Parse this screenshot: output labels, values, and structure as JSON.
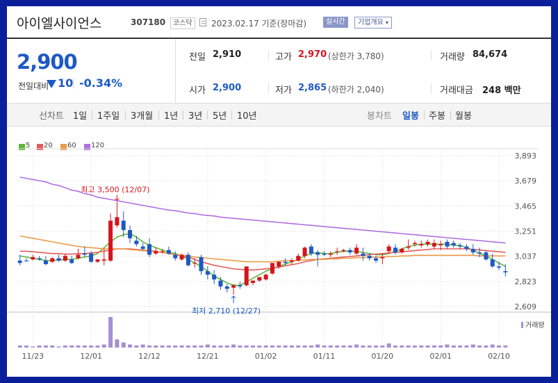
{
  "header": {
    "name": "아이엘사이언스",
    "code": "307180",
    "market": "코스닥",
    "date_text": "2023.02.17 기준(장마감)",
    "realtime_label": "실시간",
    "company_label": "기업개요"
  },
  "quote": {
    "price": "2,900",
    "change_label": "전일대비",
    "change": "10",
    "change_pct": "-0.34%"
  },
  "stats": {
    "prev_label": "전일",
    "prev_value": "2,910",
    "high_label": "고가",
    "high_value": "2,970",
    "upper_limit": "(상한가 3,780)",
    "volume_label": "거래량",
    "volume_value": "84,674",
    "open_label": "시가",
    "open_value": "2,900",
    "low_label": "저가",
    "low_value": "2,865",
    "lower_limit": "(하한가 2,040)",
    "amount_label": "거래대금",
    "amount_value": "248 백만"
  },
  "toolbar": {
    "line_label": "선차트",
    "periods": [
      "1일",
      "1주일",
      "3개월",
      "1년",
      "3년",
      "5년",
      "10년"
    ],
    "candle_label": "봉차트",
    "candles": [
      "일봉",
      "주봉",
      "월봉"
    ]
  },
  "colors": {
    "up": "#d5141c",
    "down": "#1d59c3",
    "ma5": "#61b63a",
    "ma20": "#e55a5a",
    "ma60": "#ec9a45",
    "ma120": "#b06fe0"
  },
  "chart_data": {
    "type": "candlestick",
    "ylim": [
      2609,
      3893
    ],
    "y_ticks": [
      "3,893",
      "3,679",
      "3,465",
      "3,251",
      "3,037",
      "2,823",
      "2,609"
    ],
    "x_ticks": [
      "11/23",
      "12/01",
      "12/12",
      "12/21",
      "01/02",
      "01/11",
      "01/20",
      "02/01",
      "02/10"
    ],
    "x_tick_index": [
      2,
      11,
      20,
      29,
      38,
      47,
      56,
      65,
      74
    ],
    "volume_label": "거래량",
    "high_annotation": "최고 3,500 (12/07)",
    "low_annotation": "최저 2,710 (12/27)",
    "high_index": 15,
    "low_index": 33,
    "candles": [
      [
        3000,
        3050,
        2980,
        2960
      ],
      [
        3000,
        3020,
        2995,
        2990
      ],
      [
        3010,
        3050,
        3030,
        3000
      ],
      [
        3020,
        3040,
        3010,
        3000
      ],
      [
        3000,
        3040,
        2970,
        2960
      ],
      [
        2990,
        3030,
        3020,
        2980
      ],
      [
        3020,
        3050,
        3000,
        2990
      ],
      [
        3000,
        3060,
        3040,
        2990
      ],
      [
        3010,
        3040,
        2980,
        2970
      ],
      [
        3020,
        3100,
        3050,
        3010
      ],
      [
        3060,
        3120,
        3050,
        3030
      ],
      [
        3060,
        3080,
        2990,
        2980
      ],
      [
        2990,
        3010,
        3010,
        2980
      ],
      [
        3000,
        3100,
        3010,
        2960
      ],
      [
        3000,
        3400,
        3340,
        2990
      ],
      [
        3300,
        3500,
        3370,
        3280
      ],
      [
        3340,
        3420,
        3260,
        3200
      ],
      [
        3260,
        3300,
        3190,
        3150
      ],
      [
        3170,
        3210,
        3140,
        3120
      ],
      [
        3120,
        3150,
        3100,
        3090
      ],
      [
        3140,
        3190,
        3050,
        3030
      ],
      [
        3060,
        3110,
        3080,
        3050
      ],
      [
        3080,
        3100,
        3080,
        3060
      ],
      [
        3090,
        3120,
        3060,
        3050
      ],
      [
        3050,
        3080,
        3020,
        3000
      ],
      [
        3010,
        3060,
        3050,
        3000
      ],
      [
        3050,
        3070,
        2960,
        2950
      ],
      [
        2980,
        3020,
        2980,
        2940
      ],
      [
        3030,
        3050,
        2910,
        2880
      ],
      [
        2910,
        2950,
        2880,
        2840
      ],
      [
        2880,
        2920,
        2840,
        2800
      ],
      [
        2830,
        2860,
        2780,
        2750
      ],
      [
        2780,
        2800,
        2760,
        2730
      ],
      [
        2770,
        2800,
        2790,
        2710
      ],
      [
        2790,
        2820,
        2780,
        2760
      ],
      [
        2790,
        2950,
        2950,
        2780
      ],
      [
        2810,
        2830,
        2830,
        2790
      ],
      [
        2830,
        2850,
        2860,
        2820
      ],
      [
        2840,
        2890,
        2880,
        2830
      ],
      [
        2890,
        2950,
        2980,
        2880
      ],
      [
        2950,
        2980,
        2990,
        2930
      ],
      [
        2990,
        3020,
        2980,
        2960
      ],
      [
        2990,
        3020,
        3000,
        2970
      ],
      [
        3000,
        3060,
        3040,
        2990
      ],
      [
        3040,
        3120,
        3110,
        3020
      ],
      [
        3120,
        3140,
        3060,
        3040
      ],
      [
        3070,
        3090,
        3050,
        2950
      ],
      [
        3060,
        3080,
        3050,
        3040
      ],
      [
        3050,
        3080,
        3060,
        3030
      ],
      [
        3080,
        3110,
        3080,
        3050
      ],
      [
        3080,
        3100,
        3090,
        3070
      ],
      [
        3090,
        3110,
        3070,
        3050
      ],
      [
        3060,
        3140,
        3110,
        3050
      ],
      [
        3060,
        3110,
        3040,
        3000
      ],
      [
        3040,
        3060,
        3020,
        3000
      ],
      [
        3020,
        3040,
        3000,
        2980
      ],
      [
        3020,
        3060,
        3030,
        2970
      ],
      [
        3080,
        3140,
        3120,
        3060
      ],
      [
        3110,
        3140,
        3070,
        3050
      ],
      [
        3070,
        3110,
        3100,
        3060
      ],
      [
        3110,
        3180,
        3120,
        3090
      ],
      [
        3140,
        3170,
        3150,
        3120
      ],
      [
        3130,
        3170,
        3140,
        3110
      ],
      [
        3140,
        3180,
        3160,
        3120
      ],
      [
        3120,
        3180,
        3150,
        3100
      ],
      [
        3130,
        3170,
        3140,
        3090
      ],
      [
        3160,
        3180,
        3120,
        3100
      ],
      [
        3150,
        3170,
        3130,
        3110
      ],
      [
        3130,
        3150,
        3120,
        3100
      ],
      [
        3120,
        3140,
        3100,
        3080
      ],
      [
        3100,
        3140,
        3070,
        3050
      ],
      [
        3070,
        3110,
        3060,
        3030
      ],
      [
        3070,
        3090,
        3010,
        3000
      ],
      [
        3010,
        3060,
        2950,
        2940
      ],
      [
        2950,
        2990,
        2940,
        2920
      ],
      [
        2910,
        2970,
        2900,
        2865
      ]
    ],
    "volume": [
      2,
      2,
      1,
      2,
      2,
      2,
      1,
      2,
      2,
      2,
      2,
      2,
      2,
      3,
      30,
      8,
      5,
      3,
      2,
      3,
      2,
      2,
      2,
      2,
      2,
      2,
      2,
      2,
      2,
      3,
      2,
      2,
      2,
      3,
      2,
      2,
      2,
      2,
      2,
      2,
      2,
      2,
      2,
      2,
      2,
      2,
      3,
      2,
      2,
      2,
      2,
      2,
      3,
      2,
      2,
      2,
      2,
      4,
      2,
      2,
      2,
      2,
      2,
      2,
      2,
      2,
      3,
      2,
      2,
      2,
      3,
      2,
      2,
      3,
      2,
      2
    ],
    "series": [
      {
        "name": "5",
        "color": "#61b63a",
        "values": [
          3040,
          3030,
          3020,
          3010,
          3000,
          3000,
          3005,
          3010,
          3010,
          3020,
          3030,
          3040,
          3060,
          3110,
          3160,
          3200,
          3220,
          3230,
          3200,
          3160,
          3130,
          3110,
          3090,
          3070,
          3060,
          3040,
          3010,
          2980,
          2950,
          2910,
          2870,
          2840,
          2810,
          2790,
          2790,
          2820,
          2850,
          2880,
          2910,
          2930,
          2950,
          2970,
          2990,
          3010,
          3040,
          3060,
          3070,
          3060,
          3060,
          3070,
          3080,
          3080,
          3080,
          3070,
          3060,
          3050,
          3050,
          3060,
          3080,
          3100,
          3120,
          3130,
          3140,
          3140,
          3140,
          3140,
          3140,
          3130,
          3130,
          3110,
          3090,
          3060,
          3040,
          3010,
          2980,
          2950
        ]
      },
      {
        "name": "20",
        "color": "#e55a5a",
        "values": [
          3080,
          3080,
          3075,
          3070,
          3065,
          3060,
          3060,
          3055,
          3055,
          3060,
          3060,
          3065,
          3070,
          3080,
          3090,
          3100,
          3100,
          3100,
          3095,
          3090,
          3085,
          3080,
          3070,
          3060,
          3050,
          3040,
          3030,
          3010,
          2990,
          2975,
          2960,
          2950,
          2940,
          2930,
          2925,
          2920,
          2920,
          2925,
          2930,
          2935,
          2945,
          2955,
          2965,
          2975,
          2990,
          3000,
          3010,
          3015,
          3020,
          3025,
          3030,
          3035,
          3040,
          3045,
          3050,
          3055,
          3060,
          3065,
          3070,
          3075,
          3080,
          3085,
          3090,
          3095,
          3100,
          3100,
          3100,
          3100,
          3100,
          3100,
          3095,
          3090,
          3085,
          3080,
          3075,
          3070
        ]
      },
      {
        "name": "60",
        "color": "#ec9a45",
        "values": [
          3210,
          3200,
          3190,
          3180,
          3170,
          3160,
          3150,
          3140,
          3130,
          3120,
          3115,
          3110,
          3105,
          3100,
          3100,
          3100,
          3100,
          3095,
          3090,
          3085,
          3080,
          3075,
          3070,
          3060,
          3050,
          3045,
          3040,
          3030,
          3025,
          3020,
          3015,
          3010,
          3005,
          3000,
          2995,
          2990,
          2990,
          2990,
          2990,
          2990,
          2995,
          3000,
          3000,
          3005,
          3005,
          3010,
          3010,
          3010,
          3015,
          3015,
          3020,
          3020,
          3025,
          3025,
          3030,
          3030,
          3030,
          3035,
          3035,
          3040,
          3040,
          3045,
          3045,
          3045,
          3045,
          3045,
          3045,
          3045,
          3045,
          3045,
          3045,
          3040,
          3040,
          3040,
          3040,
          3040
        ]
      },
      {
        "name": "120",
        "color": "#b06fe0",
        "values": [
          3710,
          3700,
          3690,
          3680,
          3670,
          3650,
          3640,
          3620,
          3600,
          3590,
          3570,
          3560,
          3540,
          3530,
          3520,
          3510,
          3500,
          3490,
          3480,
          3470,
          3460,
          3450,
          3440,
          3430,
          3425,
          3415,
          3405,
          3400,
          3390,
          3385,
          3380,
          3370,
          3365,
          3360,
          3355,
          3350,
          3345,
          3340,
          3335,
          3330,
          3325,
          3320,
          3315,
          3310,
          3305,
          3300,
          3295,
          3290,
          3285,
          3280,
          3275,
          3270,
          3265,
          3260,
          3255,
          3250,
          3245,
          3240,
          3235,
          3230,
          3225,
          3220,
          3215,
          3210,
          3205,
          3200,
          3195,
          3190,
          3185,
          3180,
          3175,
          3170,
          3165,
          3160,
          3155,
          3150
        ]
      }
    ]
  }
}
